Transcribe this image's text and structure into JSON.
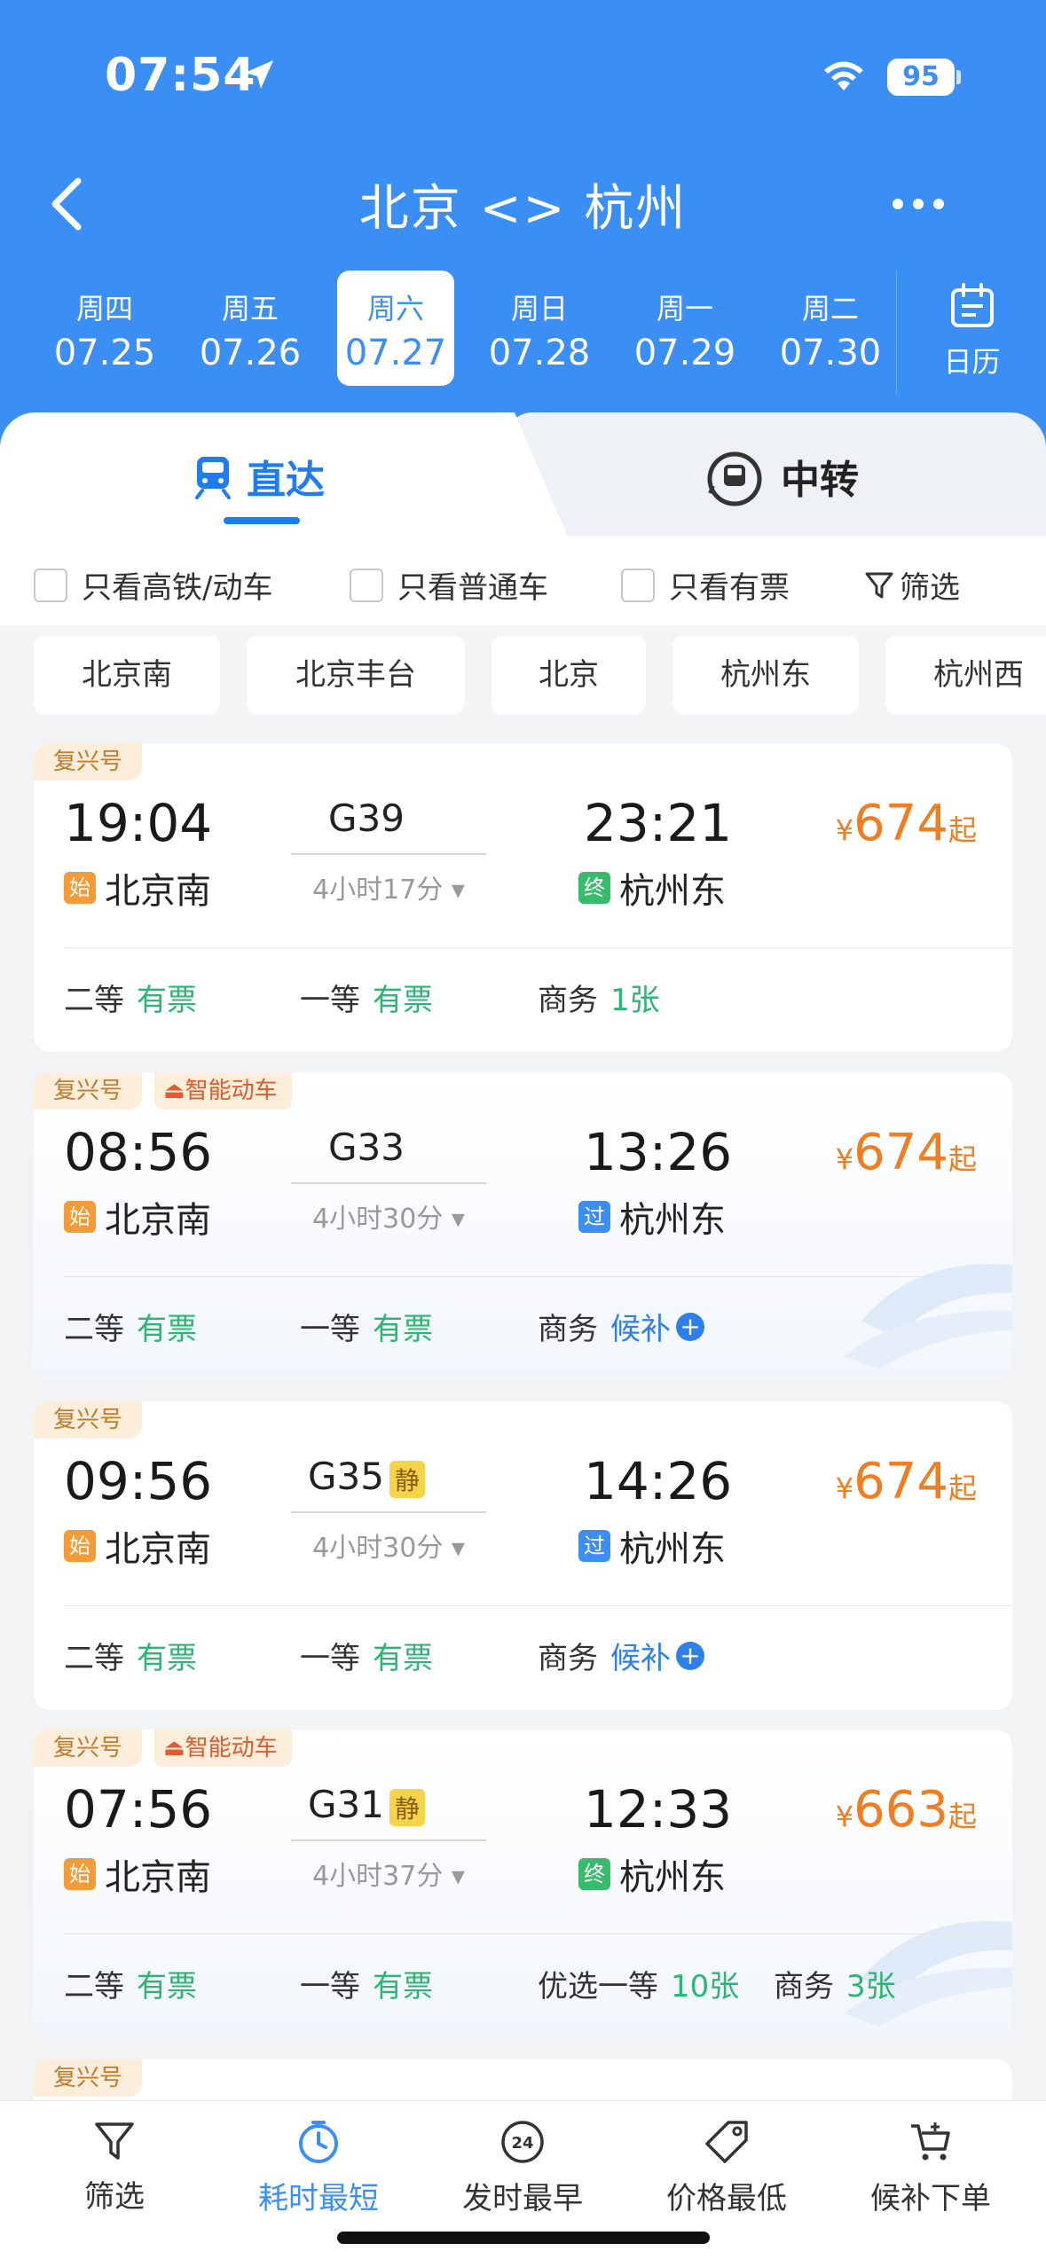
{
  "status": {
    "time": "07:54",
    "battery": "95"
  },
  "header": {
    "title": "北京 <> 杭州"
  },
  "dates": [
    {
      "weekday": "周四",
      "date": "07.25"
    },
    {
      "weekday": "周五",
      "date": "07.26"
    },
    {
      "weekday": "周六",
      "date": "07.27"
    },
    {
      "weekday": "周日",
      "date": "07.28"
    },
    {
      "weekday": "周一",
      "date": "07.29"
    },
    {
      "weekday": "周二",
      "date": "07.30"
    }
  ],
  "calendar_label": "日历",
  "tabs": {
    "direct": "直达",
    "transfer": "中转"
  },
  "filters": {
    "highspeed": "只看高铁/动车",
    "normal": "只看普通车",
    "available": "只看有票",
    "filter": "筛选"
  },
  "stations": [
    "北京南",
    "北京丰台",
    "北京",
    "杭州东",
    "杭州西"
  ],
  "trains": [
    {
      "badges": [
        "复兴号"
      ],
      "smart": "",
      "dep": "19:04",
      "arr": "23:21",
      "no": "G39",
      "quiet": "",
      "duration": "4小时17分",
      "from": "北京南",
      "from_tag": "始",
      "to": "杭州东",
      "to_tag": "终",
      "price": "674",
      "seats": [
        {
          "name": "二等",
          "value": "有票"
        },
        {
          "name": "一等",
          "value": "有票"
        },
        {
          "name": "商务",
          "value": "1张"
        }
      ]
    },
    {
      "badges": [
        "复兴号"
      ],
      "smart": "智能动车",
      "dep": "08:56",
      "arr": "13:26",
      "no": "G33",
      "quiet": "",
      "duration": "4小时30分",
      "from": "北京南",
      "from_tag": "始",
      "to": "杭州东",
      "to_tag": "过",
      "price": "674",
      "seats": [
        {
          "name": "二等",
          "value": "有票"
        },
        {
          "name": "一等",
          "value": "有票"
        },
        {
          "name": "商务",
          "value": "候补"
        }
      ]
    },
    {
      "badges": [
        "复兴号"
      ],
      "smart": "",
      "dep": "09:56",
      "arr": "14:26",
      "no": "G35",
      "quiet": "静",
      "duration": "4小时30分",
      "from": "北京南",
      "from_tag": "始",
      "to": "杭州东",
      "to_tag": "过",
      "price": "674",
      "seats": [
        {
          "name": "二等",
          "value": "有票"
        },
        {
          "name": "一等",
          "value": "有票"
        },
        {
          "name": "商务",
          "value": "候补"
        }
      ]
    },
    {
      "badges": [
        "复兴号"
      ],
      "smart": "智能动车",
      "dep": "07:56",
      "arr": "12:33",
      "no": "G31",
      "quiet": "静",
      "duration": "4小时37分",
      "from": "北京南",
      "from_tag": "始",
      "to": "杭州东",
      "to_tag": "终",
      "price": "663",
      "seats": [
        {
          "name": "二等",
          "value": "有票"
        },
        {
          "name": "一等",
          "value": "有票"
        },
        {
          "name": "优选一等",
          "value": "10张"
        },
        {
          "name": "商务",
          "value": "3张"
        }
      ]
    }
  ],
  "next_badge": "复兴号",
  "price_prefix": "¥",
  "price_suffix": "起",
  "bottom_nav": [
    {
      "label": "筛选",
      "icon": "filter-icon"
    },
    {
      "label": "耗时最短",
      "icon": "clock-icon"
    },
    {
      "label": "发时最早",
      "icon": "24h-icon"
    },
    {
      "label": "价格最低",
      "icon": "price-tag-icon"
    },
    {
      "label": "候补下单",
      "icon": "cart-icon"
    }
  ],
  "colors": {
    "primary": "#3b8ef3",
    "price": "#f07d1f",
    "available": "#2bb673",
    "waitlist": "#2f7fe8"
  }
}
